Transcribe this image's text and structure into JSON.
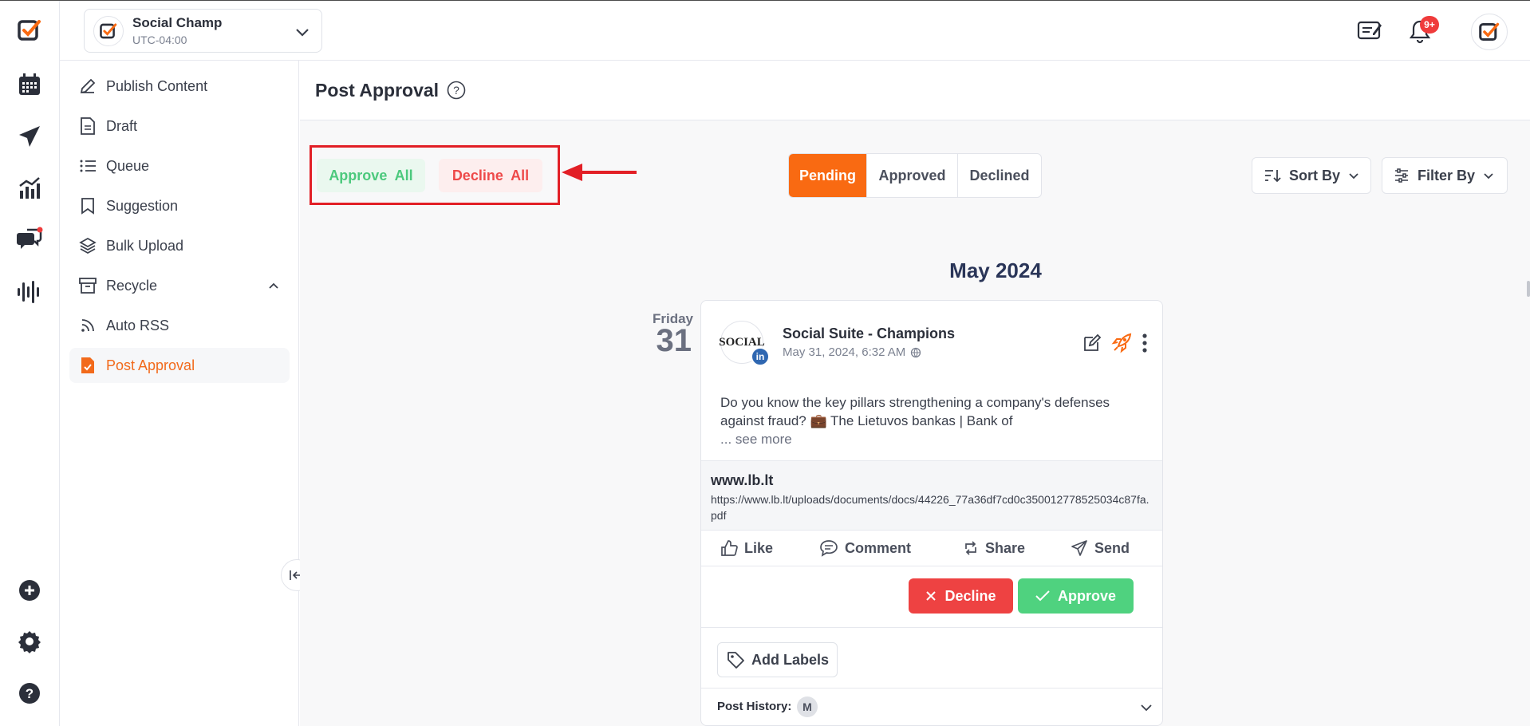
{
  "account": {
    "name": "Social Champ",
    "timezone": "UTC-04:00"
  },
  "header": {
    "notification_count": "9+"
  },
  "sidebar": {
    "items": [
      {
        "label": "Publish Content",
        "icon": "pencil-icon"
      },
      {
        "label": "Draft",
        "icon": "document-icon"
      },
      {
        "label": "Queue",
        "icon": "list-icon"
      },
      {
        "label": "Suggestion",
        "icon": "bookmark-icon"
      },
      {
        "label": "Bulk Upload",
        "icon": "layers-icon"
      },
      {
        "label": "Recycle",
        "icon": "archive-icon"
      },
      {
        "label": "Auto RSS",
        "icon": "rss-icon"
      },
      {
        "label": "Post Approval",
        "icon": "approval-doc-icon"
      }
    ],
    "active": "Post Approval"
  },
  "page": {
    "title": "Post Approval"
  },
  "bulk": {
    "approve_all": "Approve  All",
    "decline_all": "Decline  All"
  },
  "tabs": {
    "pending": "Pending",
    "approved": "Approved",
    "declined": "Declined",
    "active": "Pending"
  },
  "controls": {
    "sort_by": "Sort By",
    "filter_by": "Filter By"
  },
  "month_label": "May 2024",
  "day": {
    "weekday": "Friday",
    "number": "31"
  },
  "post": {
    "avatar_text": "SOCIAL",
    "network": "in",
    "profile_name": "Social Suite - Champions",
    "timestamp": "May 31, 2024, 6:32 AM",
    "body": "Do you know the key pillars strengthening a company's defenses against fraud? 💼 The Lietuvos bankas | Bank of",
    "see_more": "... see more",
    "link_domain": "www.lb.lt",
    "link_url": "https://www.lb.lt/uploads/documents/docs/44226_77a36df7cd0c350012778525034c87fa.pdf",
    "actions": {
      "like": "Like",
      "comment": "Comment",
      "share": "Share",
      "send": "Send"
    },
    "decline": "Decline",
    "approve": "Approve",
    "add_labels": "Add Labels",
    "history_label": "Post History:",
    "history_avatar": "M"
  },
  "colors": {
    "brand_orange": "#f96a12",
    "approve_green": "#4fd27f",
    "decline_red": "#ee4242",
    "highlight_red": "#e21f26"
  }
}
